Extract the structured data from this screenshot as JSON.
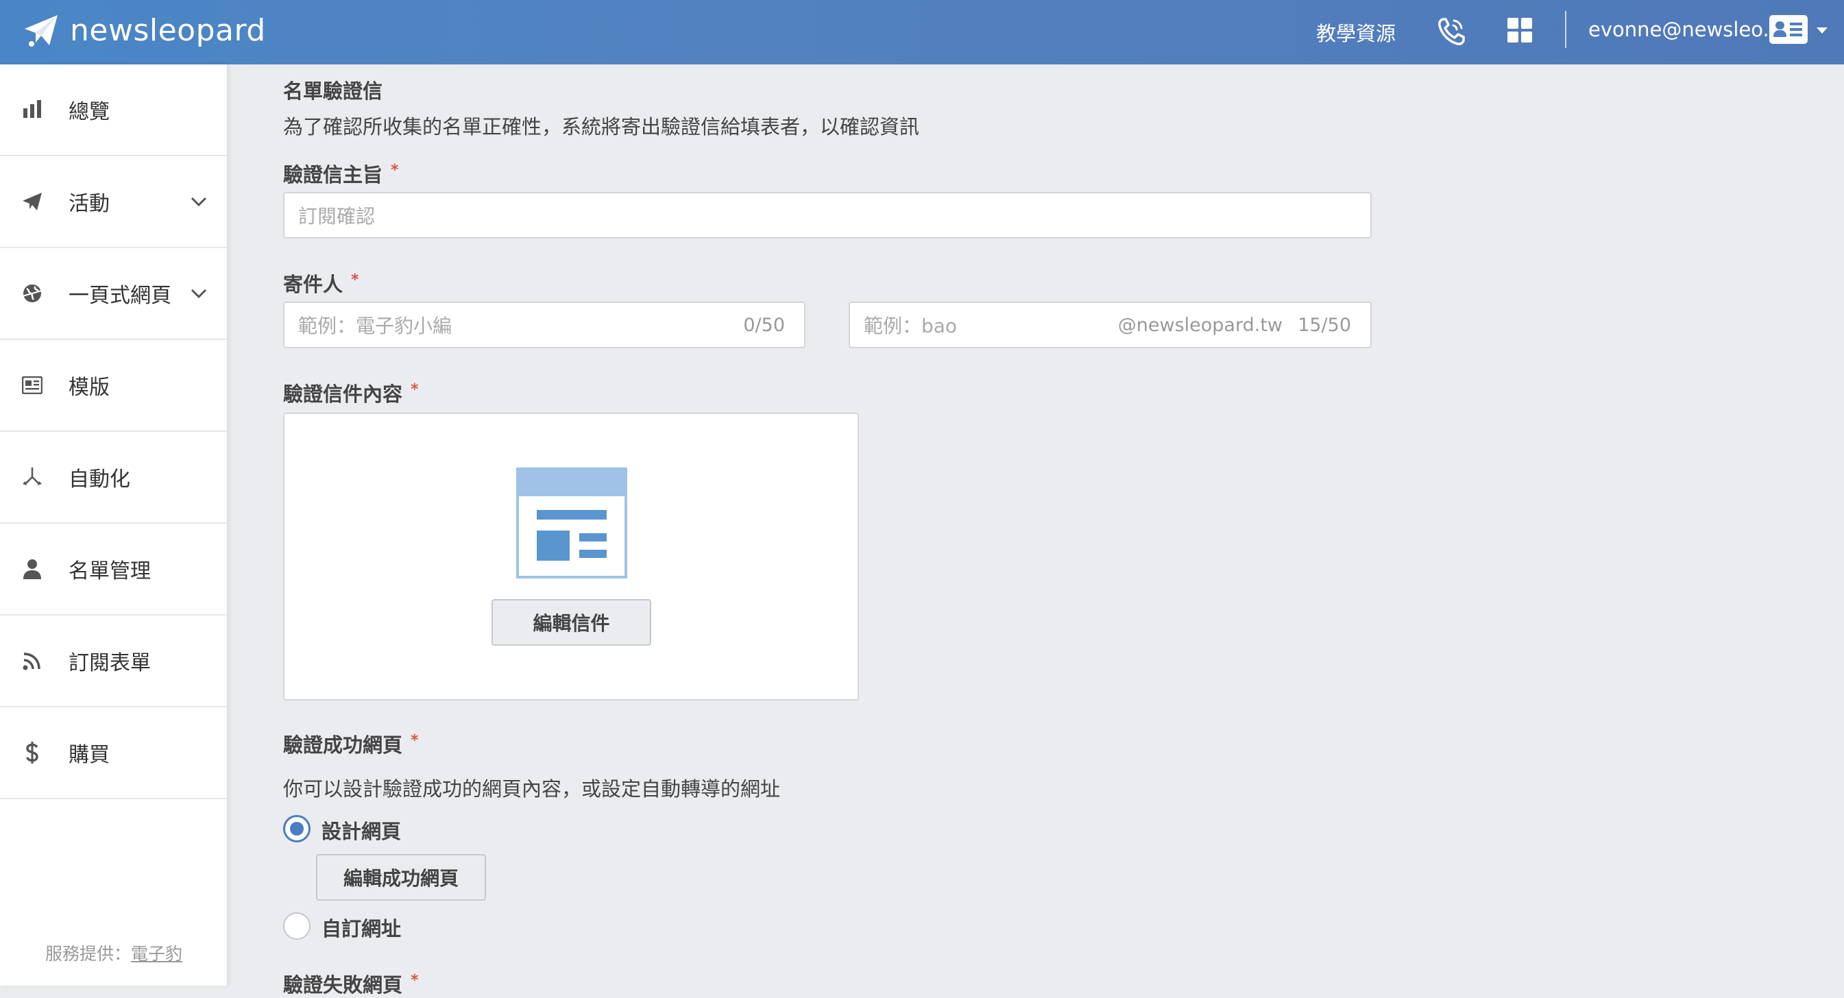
{
  "header": {
    "brand": "newsleopard",
    "tutorial": "教學資源",
    "email": "evonne@newsleo..."
  },
  "sidebar": {
    "items": [
      {
        "label": "總覽",
        "icon": "bar-chart-icon",
        "has_submenu": false
      },
      {
        "label": "活動",
        "icon": "paper-plane-icon",
        "has_submenu": true
      },
      {
        "label": "一頁式網頁",
        "icon": "globe-icon",
        "has_submenu": true
      },
      {
        "label": "模版",
        "icon": "newspaper-icon",
        "has_submenu": false
      },
      {
        "label": "自動化",
        "icon": "workflow-icon",
        "has_submenu": false
      },
      {
        "label": "名單管理",
        "icon": "user-icon",
        "has_submenu": false
      },
      {
        "label": "訂閱表單",
        "icon": "rss-icon",
        "has_submenu": false
      },
      {
        "label": "購買",
        "icon": "dollar-icon",
        "has_submenu": false
      }
    ],
    "footer_prefix": "服務提供：",
    "footer_link": "電子豹"
  },
  "main": {
    "section_title": "名單驗證信",
    "section_desc": "為了確認所收集的名單正確性，系統將寄出驗證信給填表者，以確認資訊",
    "subject": {
      "label": "驗證信主旨",
      "placeholder": "訂閱確認"
    },
    "sender": {
      "label": "寄件人",
      "name_placeholder": "範例：電子豹小編",
      "name_counter": "0/50",
      "address_placeholder": "範例：bao",
      "domain": "@newsleopard.tw",
      "address_counter": "15/50"
    },
    "content": {
      "label": "驗證信件內容",
      "edit_button": "編輯信件"
    },
    "success_page": {
      "label": "驗證成功網頁",
      "desc": "你可以設計驗證成功的網頁內容，或設定自動轉導的網址",
      "option_design": "設計網頁",
      "edit_button": "編輯成功網頁",
      "option_custom_url": "自訂網址",
      "selected": "設計網頁"
    },
    "fail_page": {
      "label": "驗證失敗網頁"
    }
  },
  "required_mark": "*",
  "colors": {
    "header_bg": "#4f7fbd",
    "accent": "#4a7cc0",
    "required": "#d9534f"
  }
}
